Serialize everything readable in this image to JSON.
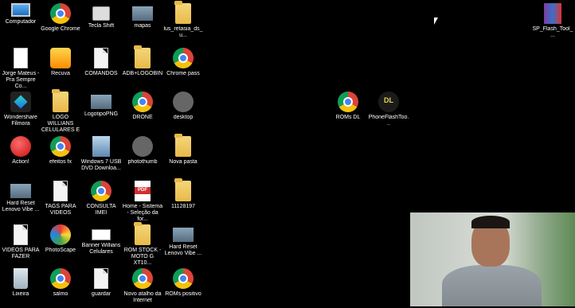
{
  "desktop": {
    "icons": [
      {
        "label": "Computador",
        "kind": "pc"
      },
      {
        "label": "Google Chrome",
        "kind": "chrome"
      },
      {
        "label": "Tecla Shift",
        "kind": "shift"
      },
      {
        "label": "mapas",
        "kind": "image"
      },
      {
        "label": "lus_retasia_ds_u...",
        "kind": "folder"
      },
      {
        "label": "Jorge Mateus - Pra Sempre Co...",
        "kind": "mp3"
      },
      {
        "label": "Recuva",
        "kind": "recuva"
      },
      {
        "label": "COMANDOS",
        "kind": "file"
      },
      {
        "label": "ADB+LOGOBIN",
        "kind": "folder"
      },
      {
        "label": "Chrome pass",
        "kind": "chrome"
      },
      {
        "label": "Wondershare Filmora",
        "kind": "filmora"
      },
      {
        "label": "LOGO WILLIANS CELULARES E I...",
        "kind": "folder"
      },
      {
        "label": "LogotipoPNG",
        "kind": "image"
      },
      {
        "label": "DRONE",
        "kind": "chrome"
      },
      {
        "label": "desktop",
        "kind": "gear"
      },
      {
        "label": "Action!",
        "kind": "red"
      },
      {
        "label": "efeitos fx",
        "kind": "chrome"
      },
      {
        "label": "Windows 7 USB DVD Downloa...",
        "kind": "usb"
      },
      {
        "label": "photothumb",
        "kind": "gear"
      },
      {
        "label": "Nova pasta",
        "kind": "folder"
      },
      {
        "label": "Hard Reset Lenovo Vibe ...",
        "kind": "image"
      },
      {
        "label": "TAGS PARA VIDEOS",
        "kind": "file"
      },
      {
        "label": "CONSULTA IMEI",
        "kind": "chrome"
      },
      {
        "label": "Home - Sistema - Seleção da for...",
        "kind": "pdf"
      },
      {
        "label": "11128197",
        "kind": "folder"
      },
      {
        "label": "VIDEOS PARA FAZER",
        "kind": "file"
      },
      {
        "label": "PhotoScape",
        "kind": "photoscape"
      },
      {
        "label": "Banner Willians Celulares",
        "kind": "banner"
      },
      {
        "label": "ROM STOCK - MOTO G XT10...",
        "kind": "folder"
      },
      {
        "label": "Hard Reset Lenovo Vibe ...",
        "kind": "image"
      },
      {
        "label": "Lixeira",
        "kind": "bin"
      },
      {
        "label": "salmo",
        "kind": "chrome"
      },
      {
        "label": "guardar",
        "kind": "file"
      },
      {
        "label": "Novo atalho da Internet",
        "kind": "chrome"
      },
      {
        "label": "ROMs positivo",
        "kind": "chrome"
      },
      {
        "label": "ROMs DL",
        "kind": "chrome"
      },
      {
        "label": "PhoneFlashToo...",
        "kind": "phoneflash"
      },
      {
        "label": "SP_Flash_Tool_...",
        "kind": "winrar"
      }
    ]
  },
  "webcam_overlay": {
    "description_icon": "webcam-feed"
  }
}
